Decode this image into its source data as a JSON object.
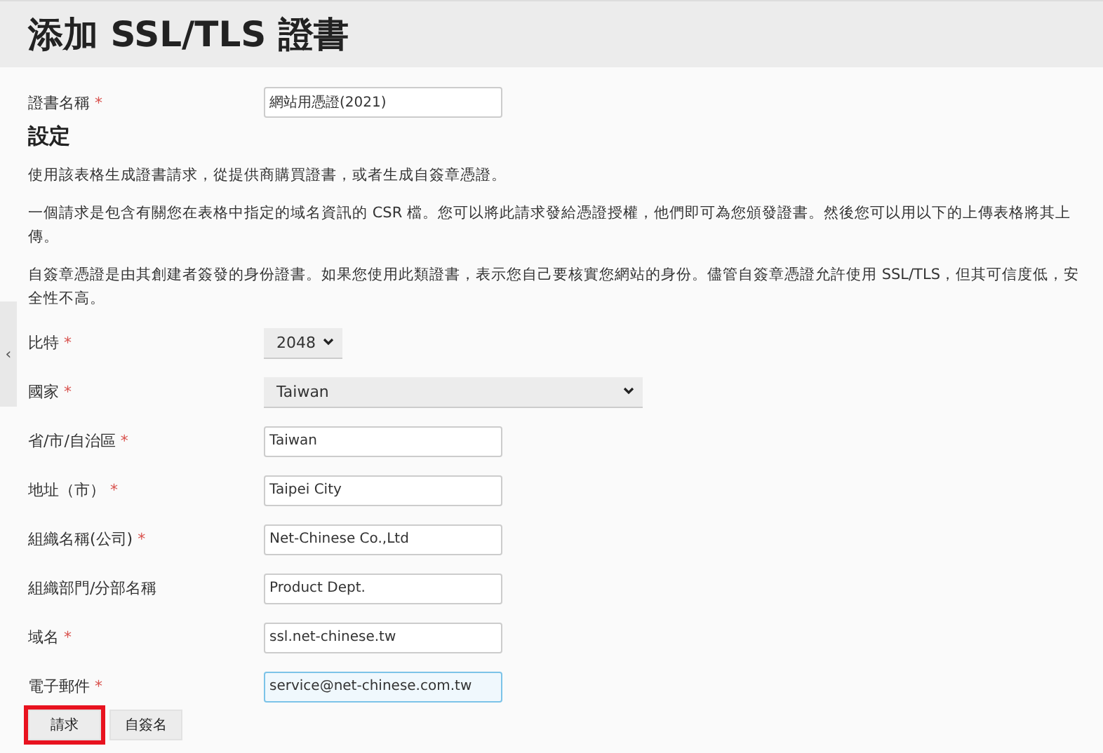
{
  "title": "添加 SSL/TLS 證書",
  "cert_name": {
    "label": "證書名稱",
    "required": true,
    "value": "網站用憑證(2021)"
  },
  "section_title": "設定",
  "paragraphs": [
    "使用該表格生成證書請求，從提供商購買證書，或者生成自簽章憑證。",
    "一個請求是包含有關您在表格中指定的域名資訊的 CSR 檔。您可以將此請求發給憑證授權，他們即可為您頒發證書。然後您可以用以下的上傳表格將其上傳。",
    "自簽章憑證是由其創建者簽發的身份證書。如果您使用此類證書，表示您自己要核實您網站的身份。儘管自簽章憑證允許使用 SSL/TLS，但其可信度低，安全性不高。"
  ],
  "fields": [
    {
      "kind": "select",
      "label": "比特",
      "required": true,
      "value": "2048",
      "wide": false,
      "focused": false
    },
    {
      "kind": "select",
      "label": "國家",
      "required": true,
      "value": "Taiwan",
      "wide": true,
      "focused": false
    },
    {
      "kind": "input",
      "label": "省/市/自治區",
      "required": true,
      "value": "Taiwan",
      "focused": false
    },
    {
      "kind": "input",
      "label": "地址（市）",
      "required": true,
      "value": "Taipei City",
      "focused": false
    },
    {
      "kind": "input",
      "label": "組織名稱(公司)",
      "required": true,
      "value": "Net-Chinese Co.,Ltd",
      "focused": false
    },
    {
      "kind": "input",
      "label": "組織部門/分部名稱",
      "required": false,
      "value": "Product Dept.",
      "focused": false
    },
    {
      "kind": "input",
      "label": "域名",
      "required": true,
      "value": "ssl.net-chinese.tw",
      "focused": false
    },
    {
      "kind": "input",
      "label": "電子郵件",
      "required": true,
      "value": "service@net-chinese.com.tw",
      "focused": true
    }
  ],
  "buttons": [
    {
      "label": "請求",
      "highlighted": true
    },
    {
      "label": "自簽名",
      "highlighted": false
    }
  ],
  "sidebar_toggle": {
    "label": "‹"
  },
  "required_mark": "*"
}
